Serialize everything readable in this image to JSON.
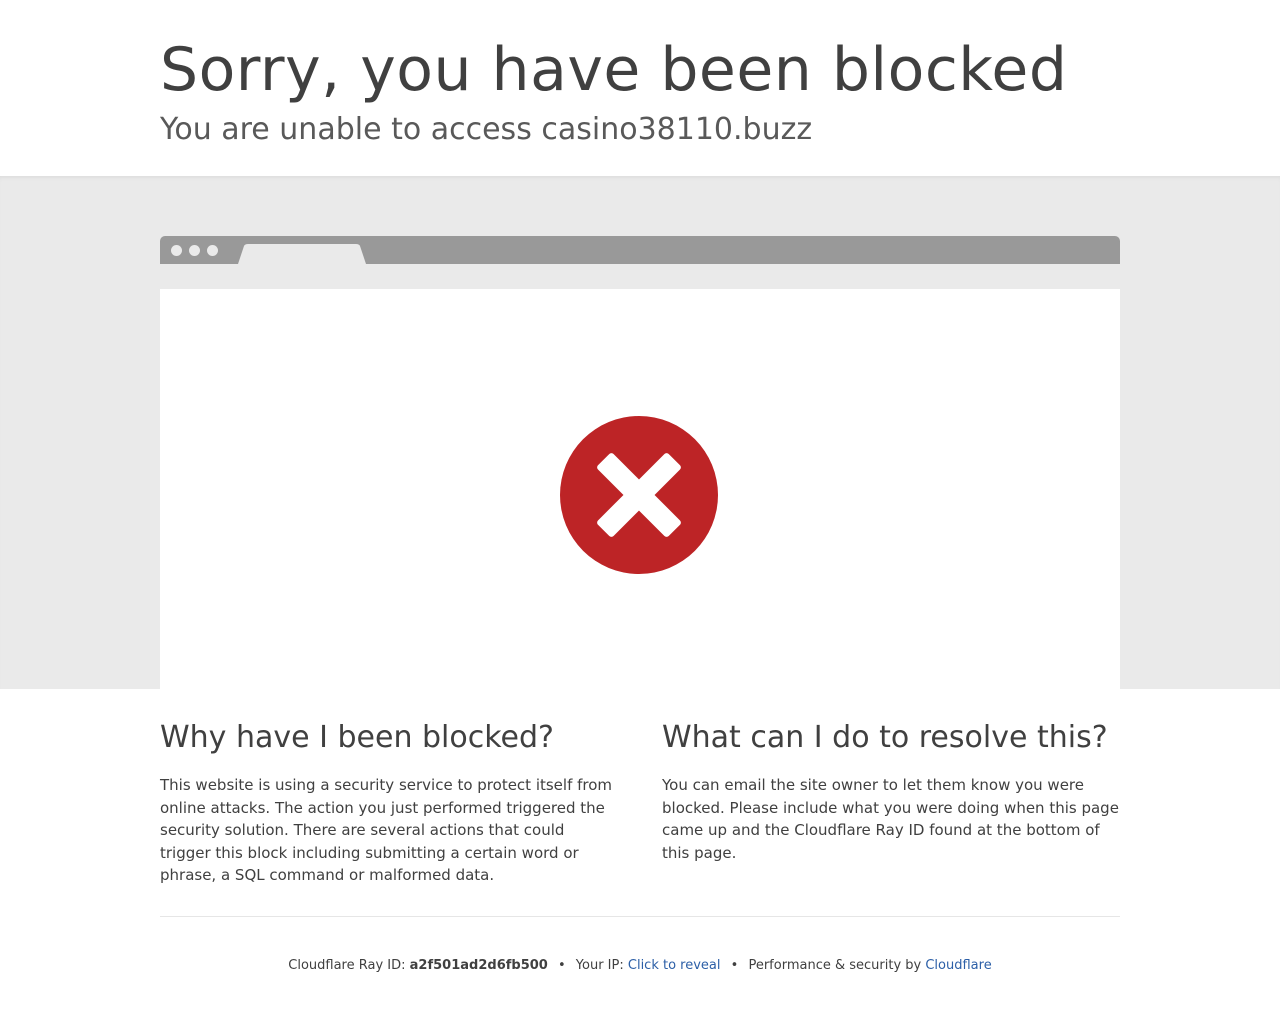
{
  "header": {
    "title": "Sorry, you have been blocked",
    "subtitle": "You are unable to access casino38110.buzz"
  },
  "browser_illustration": {
    "icon": "close-x-icon",
    "icon_color": "#bd2426"
  },
  "why_blocked": {
    "heading": "Why have I been blocked?",
    "text": "This website is using a security service to protect itself from online attacks. The action you just performed triggered the security solution. There are several actions that could trigger this block including submitting a certain word or phrase, a SQL command or malformed data."
  },
  "resolve": {
    "heading": "What can I do to resolve this?",
    "text": "You can email the site owner to let them know you were blocked. Please include what you were doing when this page came up and the Cloudflare Ray ID found at the bottom of this page."
  },
  "footer": {
    "ray_label": "Cloudflare Ray ID:",
    "ray_id": "a2f501ad2d6fb500",
    "separator": "•",
    "ip_label": "Your IP:",
    "ip_link": "Click to reveal",
    "perf_label": "Performance & security by",
    "cloudflare_link": "Cloudflare",
    "link_color": "#2c5fa7"
  }
}
